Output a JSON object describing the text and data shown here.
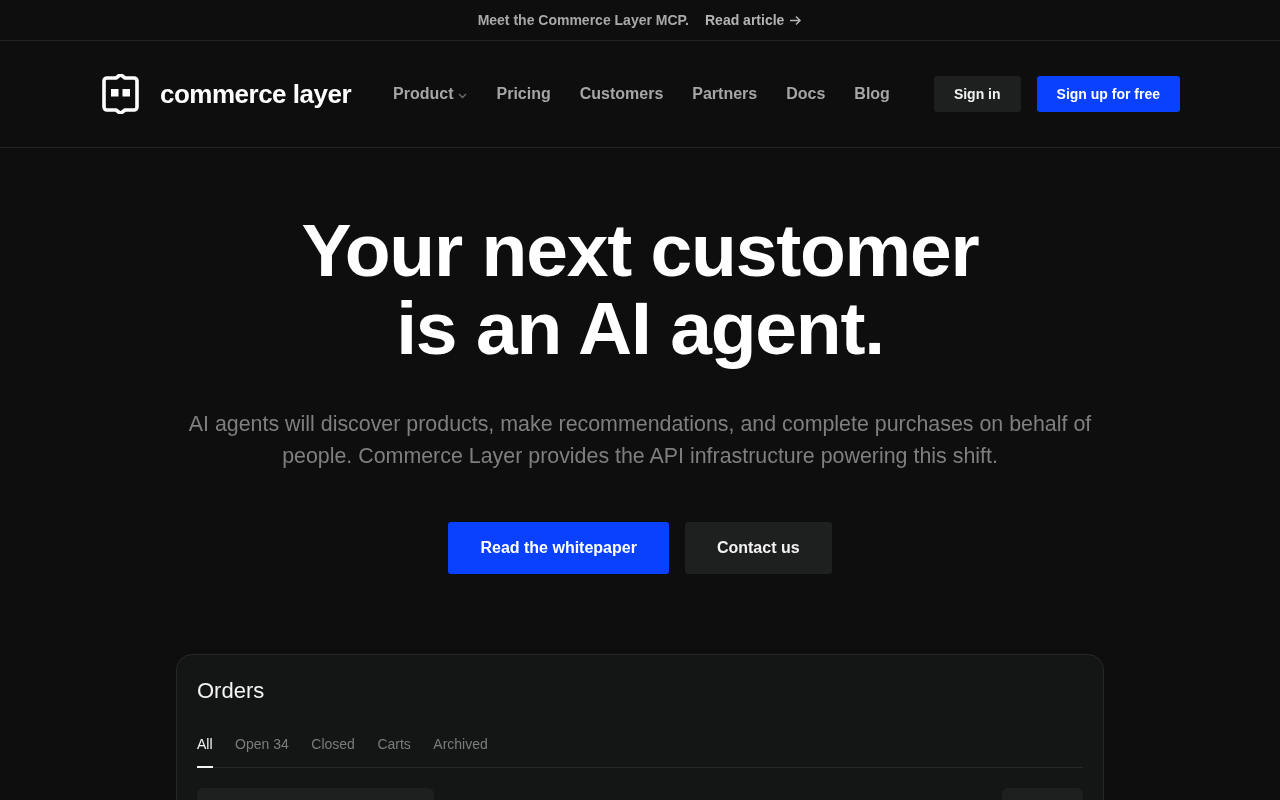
{
  "announcement": {
    "text": "Meet the Commerce Layer MCP.",
    "link": "Read article"
  },
  "nav": {
    "brand": "commerce layer",
    "items": [
      {
        "label": "Product",
        "has_menu": true
      },
      {
        "label": "Pricing",
        "has_menu": false
      },
      {
        "label": "Customers",
        "has_menu": false
      },
      {
        "label": "Partners",
        "has_menu": false
      },
      {
        "label": "Docs",
        "has_menu": false
      },
      {
        "label": "Blog",
        "has_menu": false
      }
    ],
    "actions": [
      {
        "label": "Sign in",
        "kind": "secondary"
      },
      {
        "label": "Sign up for free",
        "kind": "primary"
      }
    ]
  },
  "hero": {
    "title_lines": [
      "Your next customer",
      "is an AI agent."
    ],
    "subtitle": "AI agents will discover products, make recommendations, and complete purchases on behalf of people. Commerce Layer provides the API infrastructure powering this shift.",
    "buttons": [
      {
        "label": "Read the whitepaper",
        "kind": "primary"
      },
      {
        "label": "Contact us",
        "kind": "secondary"
      }
    ]
  },
  "orders_panel": {
    "title": "Orders",
    "tabs": [
      {
        "label": "All",
        "selected": true
      },
      {
        "label": "Open 34",
        "selected": false
      },
      {
        "label": "Closed",
        "selected": false
      },
      {
        "label": "Carts",
        "selected": false
      },
      {
        "label": "Archived",
        "selected": false
      }
    ]
  }
}
